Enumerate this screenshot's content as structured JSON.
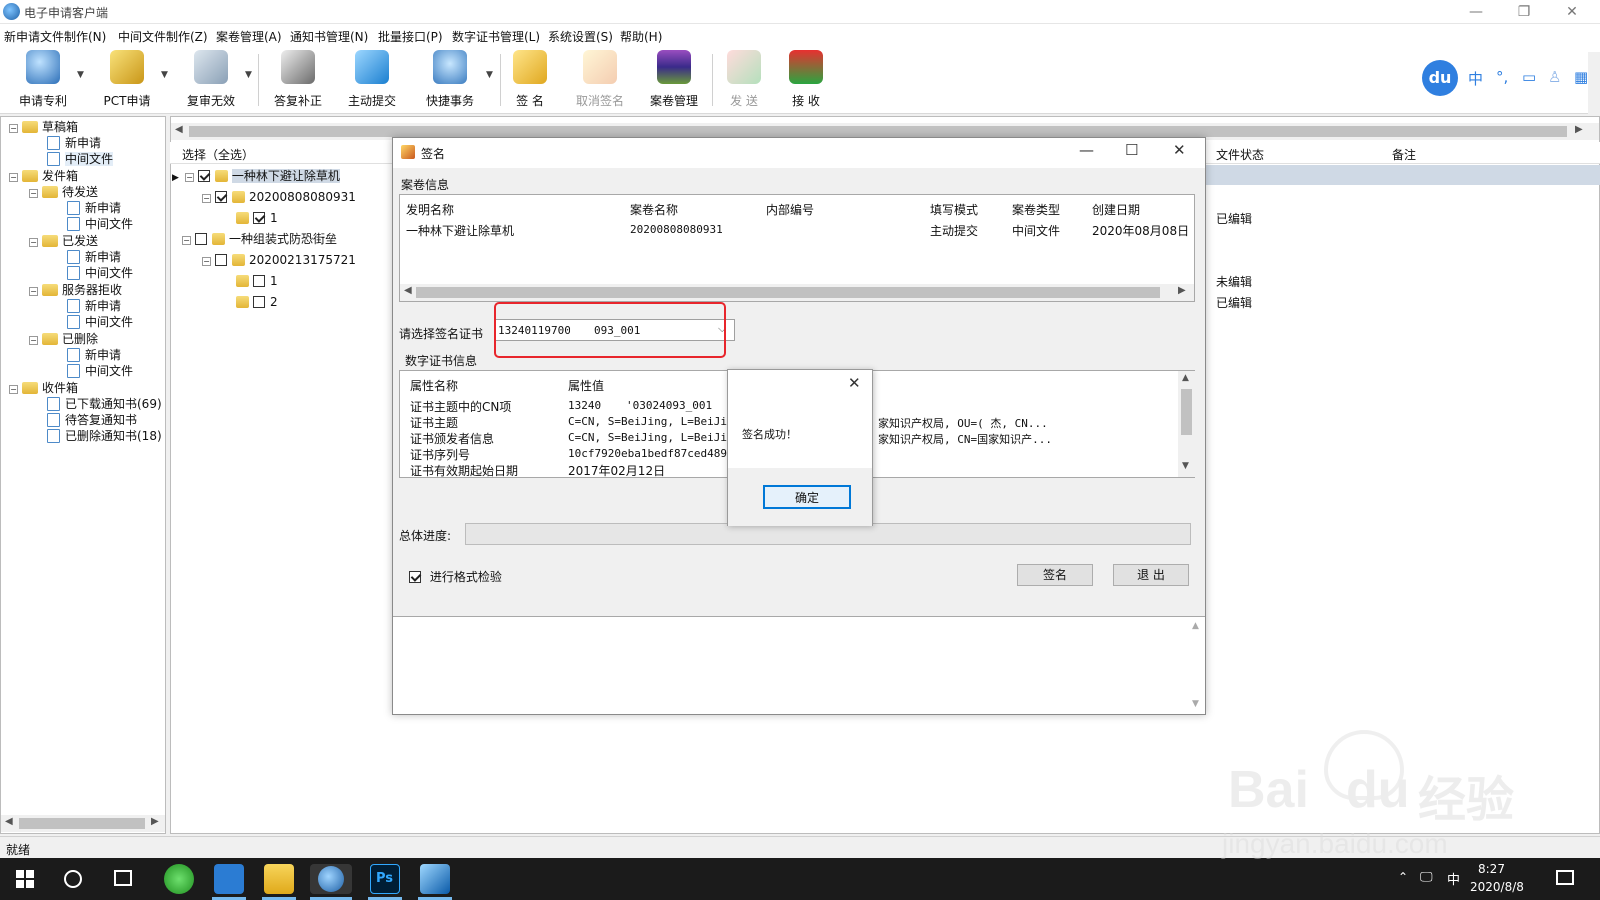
{
  "window": {
    "title": "电子申请客户端"
  },
  "menu": [
    "新申请文件制作(N)",
    "中间文件制作(Z)",
    "案卷管理(A)",
    "通知书管理(N)",
    "批量接口(P)",
    "数字证书管理(L)",
    "系统设置(S)",
    "帮助(H)"
  ],
  "toolbar": {
    "buttons": [
      "申请专利",
      "PCT申请",
      "复审无效",
      "答复补正",
      "主动提交",
      "快捷事务",
      "签 名",
      "取消签名",
      "案卷管理",
      "发 送",
      "接 收"
    ]
  },
  "ime": {
    "logo": "du",
    "lang": "中",
    "punct": "°,"
  },
  "tree": {
    "drafts": "草稿箱",
    "new": "新申请",
    "mid": "中间文件",
    "outbox": "发件箱",
    "pending": "待发送",
    "sent": "已发送",
    "rejected": "服务器拒收",
    "deleted": "已删除",
    "inbox": "收件箱",
    "downloaded": "已下载通知书(69)",
    "toreply": "待答复通知书",
    "deleted_notices": "已删除通知书(18)"
  },
  "middle": {
    "header": "选择（全选）",
    "col_status": "文件状态",
    "col_note": "备注",
    "rows": [
      {
        "label": "一种林下避让除草机"
      },
      {
        "label": "20200808080931"
      },
      {
        "label": "1",
        "status": "已编辑"
      },
      {
        "label": "一种组装式防恐街垒"
      },
      {
        "label": "20200213175721"
      },
      {
        "label": "1",
        "status": "未编辑"
      },
      {
        "label": "2",
        "status": "已编辑"
      }
    ]
  },
  "dialog": {
    "title": "签名",
    "case_group": "案卷信息",
    "case_columns": [
      "发明名称",
      "案卷名称",
      "内部编号",
      "填写模式",
      "案卷类型",
      "创建日期"
    ],
    "case_row": [
      "一种林下避让除草机",
      "20200808080931",
      "",
      "主动提交",
      "中间文件",
      "2020年08月08日"
    ],
    "cert_label": "请选择签名证书",
    "cert_value_a": "13240119700",
    "cert_value_b": "093_001",
    "cert_group": "数字证书信息",
    "cert_columns": [
      "属性名称",
      "属性值"
    ],
    "cert_rows": [
      [
        "证书主题中的CN项",
        "13240",
        "'03024093_001"
      ],
      [
        "证书主题",
        "C=CN, S=BeiJing, L=BeiJin",
        "家知识产权局, OU=(    杰, CN..."
      ],
      [
        "证书颁发者信息",
        "C=CN, S=BeiJing, L=BeiJin",
        "家知识产权局, CN=国家知识产..."
      ],
      [
        "证书序列号",
        "10cf7920eba1bedf87ced4893",
        ""
      ],
      [
        "证书有效期起始日期",
        "2017年02月12日",
        ""
      ]
    ],
    "progress_label": "总体进度:",
    "progress": 0,
    "format_check": "进行格式检验",
    "sign_button": "签名",
    "exit_button": "退  出"
  },
  "message": {
    "text": "签名成功！",
    "ok": "确定"
  },
  "status": {
    "text": "就绪"
  },
  "taskbar": {
    "lang": "中",
    "time": "8:27",
    "date": "2020/8/8"
  },
  "watermark": {
    "brand": "Bai",
    "brand2": "du",
    "cn": "经验",
    "url": "jingyan.baidu.com"
  }
}
